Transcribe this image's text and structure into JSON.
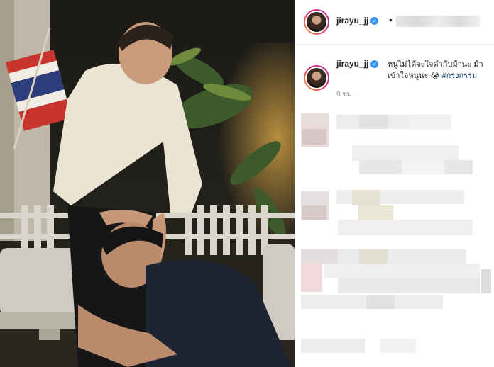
{
  "post": {
    "username": "jirayu_jj",
    "separator": "•",
    "caption": {
      "username": "jirayu_jj",
      "text": "หนูไม่ได้จะใจดำกับม้านะ ม้าเข้าใจหนูนะ",
      "emoji": "😭",
      "hashtag": "#กรงกรรม"
    },
    "time": "9 ชม."
  },
  "colors": {
    "link": "#00376b",
    "verified": "#3897f0",
    "secondary_text": "#8e8e8e"
  },
  "icons": [
    "verified-icon",
    "avatar-ring"
  ]
}
